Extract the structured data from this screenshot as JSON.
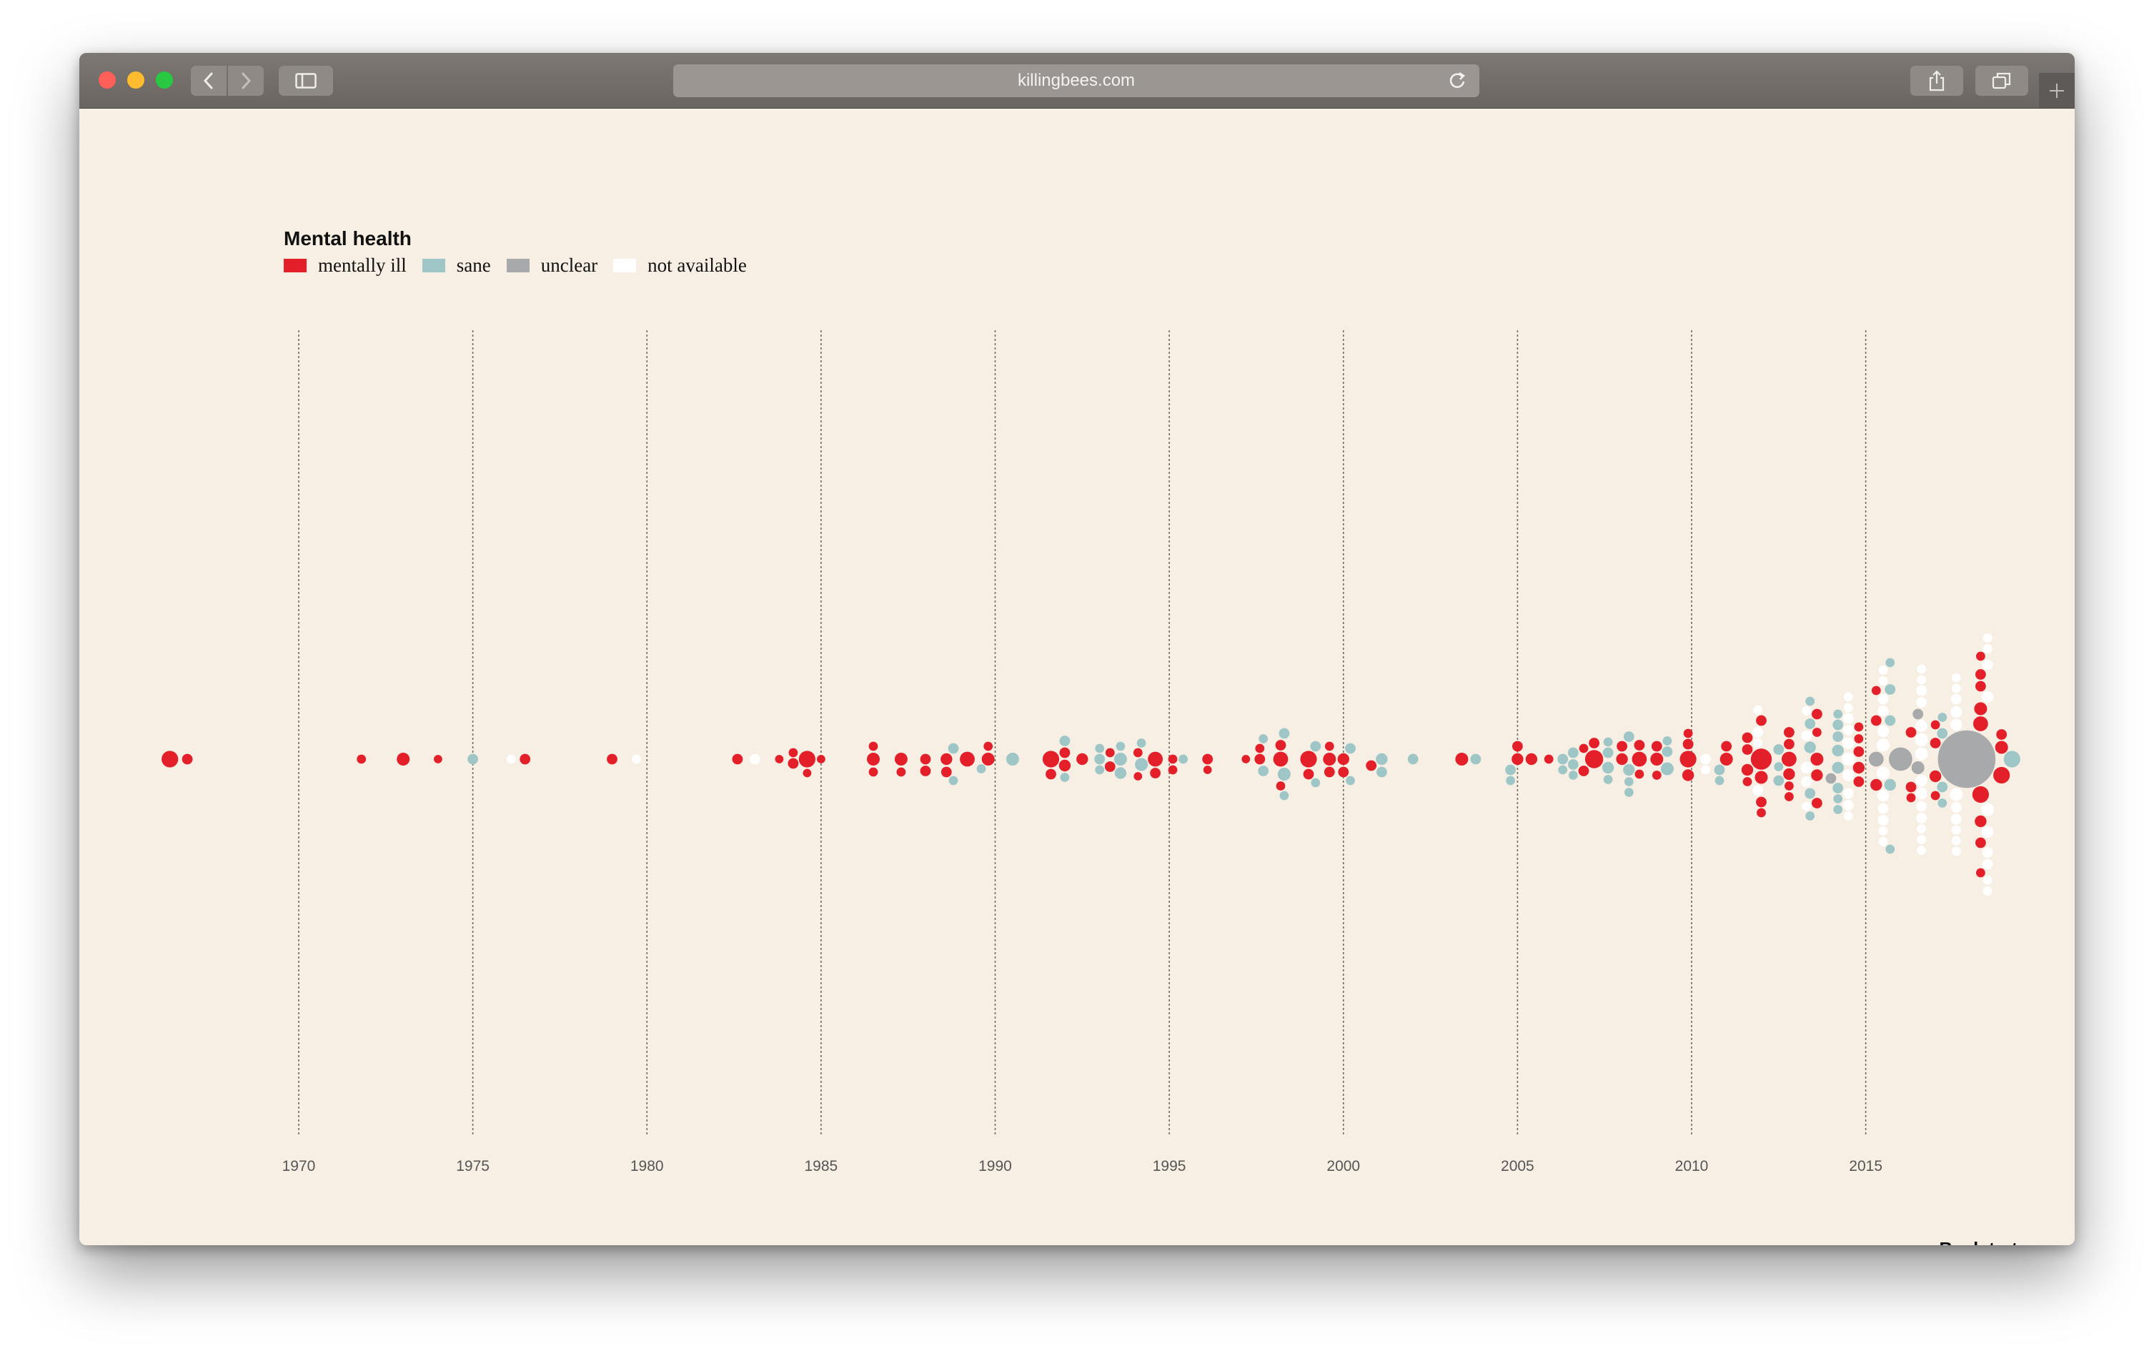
{
  "browser": {
    "url": "killingbees.com"
  },
  "page": {
    "back_to_top": "Back to top"
  },
  "chart_data": {
    "type": "scatter",
    "subtype": "beeswarm",
    "title": "Mental health",
    "xlim": [
      1963.7,
      2021
    ],
    "x_ticks": [
      1970,
      1975,
      1980,
      1985,
      1990,
      1995,
      2000,
      2005,
      2010,
      2015
    ],
    "grid": true,
    "legend_position": "top-left",
    "categories": [
      {
        "key": "ill",
        "label": "mentally ill",
        "color": "#e3202a"
      },
      {
        "key": "sane",
        "label": "sane",
        "color": "#9fc6c6"
      },
      {
        "key": "unclear",
        "label": "unclear",
        "color": "#a7a9aa"
      },
      {
        "key": "na",
        "label": "not available",
        "color": "#ffffff"
      }
    ],
    "clusters": [
      {
        "x": 1966.3,
        "c": "ill",
        "v": [
          5
        ]
      },
      {
        "x": 1966.8,
        "c": "ill",
        "v": [
          2
        ]
      },
      {
        "x": 1971.8,
        "c": "ill",
        "v": [
          1.5
        ]
      },
      {
        "x": 1973.0,
        "c": "ill",
        "v": [
          3
        ]
      },
      {
        "x": 1974.0,
        "c": "ill",
        "v": [
          1.3
        ]
      },
      {
        "x": 1975.0,
        "c": "sane",
        "v": [
          2
        ]
      },
      {
        "x": 1976.1,
        "c": "na",
        "v": [
          1.5
        ]
      },
      {
        "x": 1976.5,
        "c": "ill",
        "v": [
          2
        ]
      },
      {
        "x": 1979.0,
        "c": "ill",
        "v": [
          2
        ]
      },
      {
        "x": 1979.7,
        "c": "na",
        "v": [
          1.5
        ]
      },
      {
        "x": 1982.6,
        "c": "ill",
        "v": [
          2
        ]
      },
      {
        "x": 1983.1,
        "c": "na",
        "v": [
          2
        ]
      },
      {
        "x": 1983.8,
        "c": "ill",
        "v": [
          1.3
        ]
      },
      {
        "x": 1984.2,
        "c": "ill",
        "v": [
          2,
          1.5
        ]
      },
      {
        "x": 1984.6,
        "c": "ill",
        "v": [
          5,
          1.3
        ]
      },
      {
        "x": 1985.0,
        "c": "ill",
        "v": [
          1.3
        ]
      },
      {
        "x": 1986.5,
        "c": "ill",
        "v": [
          3,
          1.5,
          1.5
        ]
      },
      {
        "x": 1987.3,
        "c": "ill",
        "v": [
          3,
          1.5
        ]
      },
      {
        "x": 1988.0,
        "c": "ill",
        "v": [
          2,
          2
        ]
      },
      {
        "x": 1988.6,
        "c": "ill",
        "v": [
          2.5,
          2
        ]
      },
      {
        "x": 1988.8,
        "c": "sane",
        "v": [
          2,
          1.5
        ]
      },
      {
        "x": 1989.2,
        "c": "ill",
        "v": [
          4
        ]
      },
      {
        "x": 1989.6,
        "c": "sane",
        "v": [
          1.5
        ]
      },
      {
        "x": 1989.8,
        "c": "ill",
        "v": [
          3,
          1.5
        ]
      },
      {
        "x": 1990.5,
        "c": "sane",
        "v": [
          3
        ]
      },
      {
        "x": 1991.6,
        "c": "ill",
        "v": [
          5,
          2
        ]
      },
      {
        "x": 1992.0,
        "c": "ill",
        "v": [
          2.5,
          2
        ]
      },
      {
        "x": 1992.0,
        "c": "sane",
        "v": [
          2,
          1.5
        ]
      },
      {
        "x": 1992.5,
        "c": "ill",
        "v": [
          2.5
        ]
      },
      {
        "x": 1993.0,
        "c": "sane",
        "v": [
          2,
          1.5,
          1.5
        ]
      },
      {
        "x": 1993.3,
        "c": "ill",
        "v": [
          2,
          1.5
        ]
      },
      {
        "x": 1993.6,
        "c": "sane",
        "v": [
          3,
          2.5,
          1.5
        ]
      },
      {
        "x": 1994.1,
        "c": "ill",
        "v": [
          1.5,
          1.3
        ]
      },
      {
        "x": 1994.2,
        "c": "sane",
        "v": [
          3,
          1.5
        ]
      },
      {
        "x": 1994.6,
        "c": "ill",
        "v": [
          4,
          2
        ]
      },
      {
        "x": 1995.1,
        "c": "ill",
        "v": [
          1.5,
          1.5
        ]
      },
      {
        "x": 1995.4,
        "c": "sane",
        "v": [
          1.5
        ]
      },
      {
        "x": 1996.1,
        "c": "ill",
        "v": [
          2,
          1.3
        ]
      },
      {
        "x": 1997.2,
        "c": "ill",
        "v": [
          1.3
        ]
      },
      {
        "x": 1997.6,
        "c": "ill",
        "v": [
          2,
          1.5
        ]
      },
      {
        "x": 1997.7,
        "c": "sane",
        "v": [
          2,
          1.5
        ]
      },
      {
        "x": 1998.2,
        "c": "ill",
        "v": [
          4,
          2,
          1.5
        ]
      },
      {
        "x": 1998.3,
        "c": "sane",
        "v": [
          3,
          2,
          1.5
        ]
      },
      {
        "x": 1999.0,
        "c": "ill",
        "v": [
          5,
          2
        ]
      },
      {
        "x": 1999.2,
        "c": "sane",
        "v": [
          2,
          1.5
        ]
      },
      {
        "x": 1999.6,
        "c": "ill",
        "v": [
          3,
          2,
          1.5
        ]
      },
      {
        "x": 2000.0,
        "c": "ill",
        "v": [
          2.5,
          2
        ]
      },
      {
        "x": 2000.2,
        "c": "sane",
        "v": [
          2,
          1.5
        ]
      },
      {
        "x": 2000.8,
        "c": "ill",
        "v": [
          2
        ]
      },
      {
        "x": 2001.1,
        "c": "sane",
        "v": [
          2.5,
          2
        ]
      },
      {
        "x": 2002.0,
        "c": "sane",
        "v": [
          2
        ]
      },
      {
        "x": 2003.4,
        "c": "ill",
        "v": [
          3
        ]
      },
      {
        "x": 2003.8,
        "c": "sane",
        "v": [
          2
        ]
      },
      {
        "x": 2004.8,
        "c": "sane",
        "v": [
          2,
          1.5
        ]
      },
      {
        "x": 2005.0,
        "c": "ill",
        "v": [
          2.5,
          2
        ]
      },
      {
        "x": 2005.4,
        "c": "ill",
        "v": [
          2.5
        ]
      },
      {
        "x": 2005.9,
        "c": "ill",
        "v": [
          1.5
        ]
      },
      {
        "x": 2006.3,
        "c": "sane",
        "v": [
          2,
          1.5
        ]
      },
      {
        "x": 2006.6,
        "c": "sane",
        "v": [
          2,
          2,
          1.5
        ]
      },
      {
        "x": 2006.9,
        "c": "ill",
        "v": [
          2,
          1.5
        ]
      },
      {
        "x": 2007.2,
        "c": "ill",
        "v": [
          6,
          2
        ]
      },
      {
        "x": 2007.6,
        "c": "sane",
        "v": [
          2.5,
          2,
          1.5,
          1.5
        ]
      },
      {
        "x": 2008.0,
        "c": "ill",
        "v": [
          2.5,
          2
        ]
      },
      {
        "x": 2008.2,
        "c": "sane",
        "v": [
          2.5,
          2,
          1.5,
          1.5
        ]
      },
      {
        "x": 2008.5,
        "c": "ill",
        "v": [
          4,
          2,
          1.5
        ]
      },
      {
        "x": 2009.0,
        "c": "ill",
        "v": [
          3,
          2,
          1.5
        ]
      },
      {
        "x": 2009.3,
        "c": "sane",
        "v": [
          3,
          2,
          1.5
        ]
      },
      {
        "x": 2009.9,
        "c": "ill",
        "v": [
          5,
          2.5,
          2,
          1.5
        ]
      },
      {
        "x": 2010.4,
        "c": "na",
        "v": [
          2,
          1.5
        ]
      },
      {
        "x": 2010.8,
        "c": "sane",
        "v": [
          2,
          1.5
        ]
      },
      {
        "x": 2011.0,
        "c": "ill",
        "v": [
          3,
          2
        ]
      },
      {
        "x": 2011.6,
        "c": "ill",
        "v": [
          2.5,
          2,
          2,
          1.5
        ]
      },
      {
        "x": 2011.9,
        "c": "na",
        "v": [
          2,
          2,
          1.5,
          1.5
        ]
      },
      {
        "x": 2012.0,
        "c": "ill",
        "v": [
          8,
          3,
          2,
          2,
          1.5
        ]
      },
      {
        "x": 2012.5,
        "c": "sane",
        "v": [
          2,
          2,
          1.5
        ]
      },
      {
        "x": 2012.8,
        "c": "ill",
        "v": [
          4,
          2.5,
          2,
          2,
          1.5,
          1.5
        ]
      },
      {
        "x": 2013.3,
        "c": "na",
        "v": [
          2.5,
          2,
          2,
          1.5,
          1.5
        ]
      },
      {
        "x": 2013.4,
        "c": "sane",
        "v": [
          2.5,
          2,
          2,
          1.5,
          1.5
        ]
      },
      {
        "x": 2013.6,
        "c": "ill",
        "v": [
          3,
          2.5,
          2,
          2,
          1.5
        ]
      },
      {
        "x": 2014.0,
        "c": "unclear",
        "v": [
          2
        ]
      },
      {
        "x": 2014.2,
        "c": "sane",
        "v": [
          2.5,
          2.5,
          2,
          2,
          2,
          1.5,
          1.5,
          1.5
        ]
      },
      {
        "x": 2014.5,
        "c": "na",
        "v": [
          3,
          2.5,
          2.5,
          2,
          2,
          2,
          2,
          1.5,
          1.5,
          1.5
        ]
      },
      {
        "x": 2014.8,
        "c": "ill",
        "v": [
          2.5,
          2,
          2,
          1.5,
          1.5
        ]
      },
      {
        "x": 2015.3,
        "c": "unclear",
        "v": [
          4
        ]
      },
      {
        "x": 2015.3,
        "c": "ill",
        "v": [
          2.5,
          2,
          1.5
        ]
      },
      {
        "x": 2015.5,
        "c": "na",
        "v": [
          3,
          3,
          2.5,
          2.5,
          2,
          2,
          2,
          2,
          1.5,
          1.5,
          1.5,
          1.5
        ]
      },
      {
        "x": 2015.7,
        "c": "sane",
        "v": [
          2.5,
          2,
          2,
          1.5,
          1.5
        ]
      },
      {
        "x": 2016.0,
        "c": "unclear",
        "v": [
          10
        ]
      },
      {
        "x": 2016.3,
        "c": "ill",
        "v": [
          2,
          2,
          1.5
        ]
      },
      {
        "x": 2016.5,
        "c": "unclear",
        "v": [
          3,
          2
        ]
      },
      {
        "x": 2016.6,
        "c": "na",
        "v": [
          3,
          3,
          2.5,
          2.5,
          2.5,
          2,
          2,
          2,
          2,
          1.5,
          1.5,
          1.5,
          1.5,
          1.5
        ]
      },
      {
        "x": 2017.0,
        "c": "ill",
        "v": [
          2.5,
          2,
          1.5,
          1.5
        ]
      },
      {
        "x": 2017.2,
        "c": "sane",
        "v": [
          2,
          2,
          1.5,
          1.5
        ]
      },
      {
        "x": 2017.6,
        "c": "na",
        "v": [
          3,
          2.5,
          2.5,
          2,
          2,
          2,
          1.5,
          1.5,
          1.5,
          1.5,
          1.5
        ]
      },
      {
        "x": 2017.9,
        "c": "unclear",
        "v": [
          60
        ]
      },
      {
        "x": 2018.3,
        "c": "ill",
        "v": [
          5,
          4,
          3,
          2.5,
          2,
          2,
          2,
          1.5,
          1.5
        ]
      },
      {
        "x": 2018.5,
        "c": "na",
        "v": [
          3,
          2.5,
          2.5,
          2,
          2,
          2,
          1.5,
          1.5,
          1.5,
          1.5
        ]
      },
      {
        "x": 2018.9,
        "c": "ill",
        "v": [
          5,
          3,
          2
        ]
      },
      {
        "x": 2019.2,
        "c": "sane",
        "v": [
          5
        ]
      }
    ]
  }
}
